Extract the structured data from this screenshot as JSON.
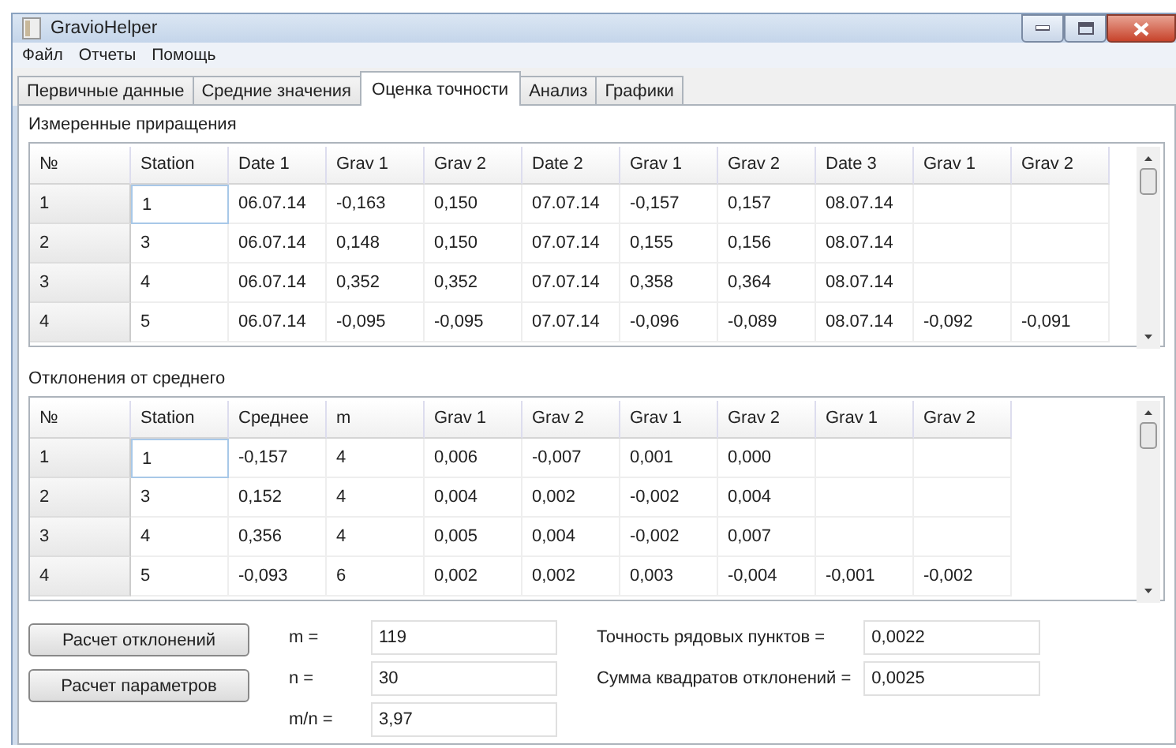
{
  "window": {
    "title": "GravioHelper"
  },
  "menu": [
    "Файл",
    "Отчеты",
    "Помощь"
  ],
  "tabs": [
    {
      "label": "Первичные данные",
      "selected": false
    },
    {
      "label": "Средние значения",
      "selected": false
    },
    {
      "label": "Оценка точности",
      "selected": true
    },
    {
      "label": "Анализ",
      "selected": false
    },
    {
      "label": "Графики",
      "selected": false
    }
  ],
  "tables": [
    {
      "title": "Измеренные приращения",
      "columns": [
        "№",
        "Station",
        "Date 1",
        "Grav 1",
        "Grav 2",
        "Date 2",
        "Grav 1",
        "Grav 2",
        "Date 3",
        "Grav 1",
        "Grav 2"
      ],
      "rows": [
        {
          "current": true,
          "cells": [
            "1",
            "1",
            "06.07.14",
            "-0,163",
            "0,150",
            "07.07.14",
            "-0,157",
            "0,157",
            "08.07.14"
          ]
        },
        {
          "current": false,
          "cells": [
            "2",
            "3",
            "06.07.14",
            "0,148",
            "0,150",
            "07.07.14",
            "0,155",
            "0,156",
            "08.07.14"
          ]
        },
        {
          "current": false,
          "cells": [
            "3",
            "4",
            "06.07.14",
            "0,352",
            "0,352",
            "07.07.14",
            "0,358",
            "0,364",
            "08.07.14"
          ]
        },
        {
          "current": false,
          "cells": [
            "4",
            "5",
            "06.07.14",
            "-0,095",
            "-0,095",
            "07.07.14",
            "-0,096",
            "-0,089",
            "08.07.14",
            "-0,092",
            "-0,091"
          ]
        }
      ]
    },
    {
      "title": "Отклонения от среднего",
      "columns": [
        "№",
        "Station",
        "Среднее",
        "m",
        "Grav 1",
        "Grav 2",
        "Grav 1",
        "Grav 2",
        "Grav 1",
        "Grav 2"
      ],
      "rows": [
        {
          "current": true,
          "cells": [
            "1",
            "1",
            "-0,157",
            "4",
            "0,006",
            "-0,007",
            "0,001",
            "0,000"
          ]
        },
        {
          "current": false,
          "cells": [
            "2",
            "3",
            "0,152",
            "4",
            "0,004",
            "0,002",
            "-0,002",
            "0,004"
          ]
        },
        {
          "current": false,
          "cells": [
            "3",
            "4",
            "0,356",
            "4",
            "0,005",
            "0,004",
            "-0,002",
            "0,007"
          ]
        },
        {
          "current": false,
          "cells": [
            "4",
            "5",
            "-0,093",
            "6",
            "0,002",
            "0,002",
            "0,003",
            "-0,004",
            "-0,001",
            "-0,002"
          ]
        }
      ]
    }
  ],
  "buttons": [
    "Расчет отклонений",
    "Расчет параметров"
  ],
  "left_fields": [
    {
      "label": "m =",
      "value": "119"
    },
    {
      "label": "n =",
      "value": "30"
    },
    {
      "label": "m/n =",
      "value": "3,97"
    }
  ],
  "right_fields": [
    {
      "label": "Точность рядовых пунктов =",
      "value": "0,0022"
    },
    {
      "label": "Сумма квадратов отклонений =",
      "value": "0,0025"
    }
  ]
}
